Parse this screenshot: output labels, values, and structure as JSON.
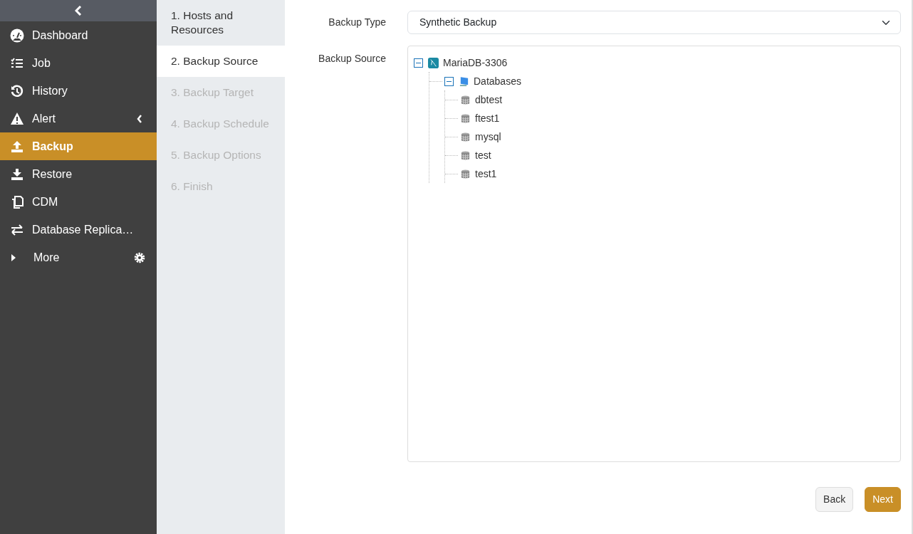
{
  "sidebar": {
    "items": [
      {
        "label": "Dashboard",
        "selected": false
      },
      {
        "label": "Job",
        "selected": false
      },
      {
        "label": "History",
        "selected": false
      },
      {
        "label": "Alert",
        "selected": false,
        "kind": "submenu",
        "expanded": false
      },
      {
        "label": "Backup",
        "selected": true
      },
      {
        "label": "Restore",
        "selected": false
      },
      {
        "label": "CDM",
        "selected": false
      },
      {
        "label": "Database Replica…",
        "selected": false
      },
      {
        "label": "More",
        "selected": false,
        "kind": "more",
        "expanded": false
      }
    ]
  },
  "steps": [
    {
      "label": "1. Hosts and Resources",
      "selected": false,
      "disabled": false
    },
    {
      "label": "2. Backup Source",
      "selected": true,
      "disabled": false
    },
    {
      "label": "3. Backup Target",
      "selected": false,
      "disabled": true
    },
    {
      "label": "4. Backup Schedule",
      "selected": false,
      "disabled": true
    },
    {
      "label": "5. Backup Options",
      "selected": false,
      "disabled": true
    },
    {
      "label": "6. Finish",
      "selected": false,
      "disabled": true
    }
  ],
  "form": {
    "backup_type": {
      "label": "Backup Type",
      "value": "Synthetic Backup"
    },
    "backup_source": {
      "label": "Backup Source",
      "tree": [
        {
          "label": "MariaDB-3306",
          "kind": "instance",
          "expanded": true,
          "children": [
            {
              "label": "Databases",
              "kind": "folder",
              "expanded": true,
              "children": [
                {
                  "label": "dbtest",
                  "kind": "database"
                },
                {
                  "label": "ftest1",
                  "kind": "database"
                },
                {
                  "label": "mysql",
                  "kind": "database"
                },
                {
                  "label": "test",
                  "kind": "database"
                },
                {
                  "label": "test1",
                  "kind": "database"
                }
              ]
            }
          ]
        }
      ]
    }
  },
  "buttons": [
    {
      "label": "Back",
      "kind": "secondary"
    },
    {
      "label": "Next",
      "kind": "primary"
    }
  ]
}
